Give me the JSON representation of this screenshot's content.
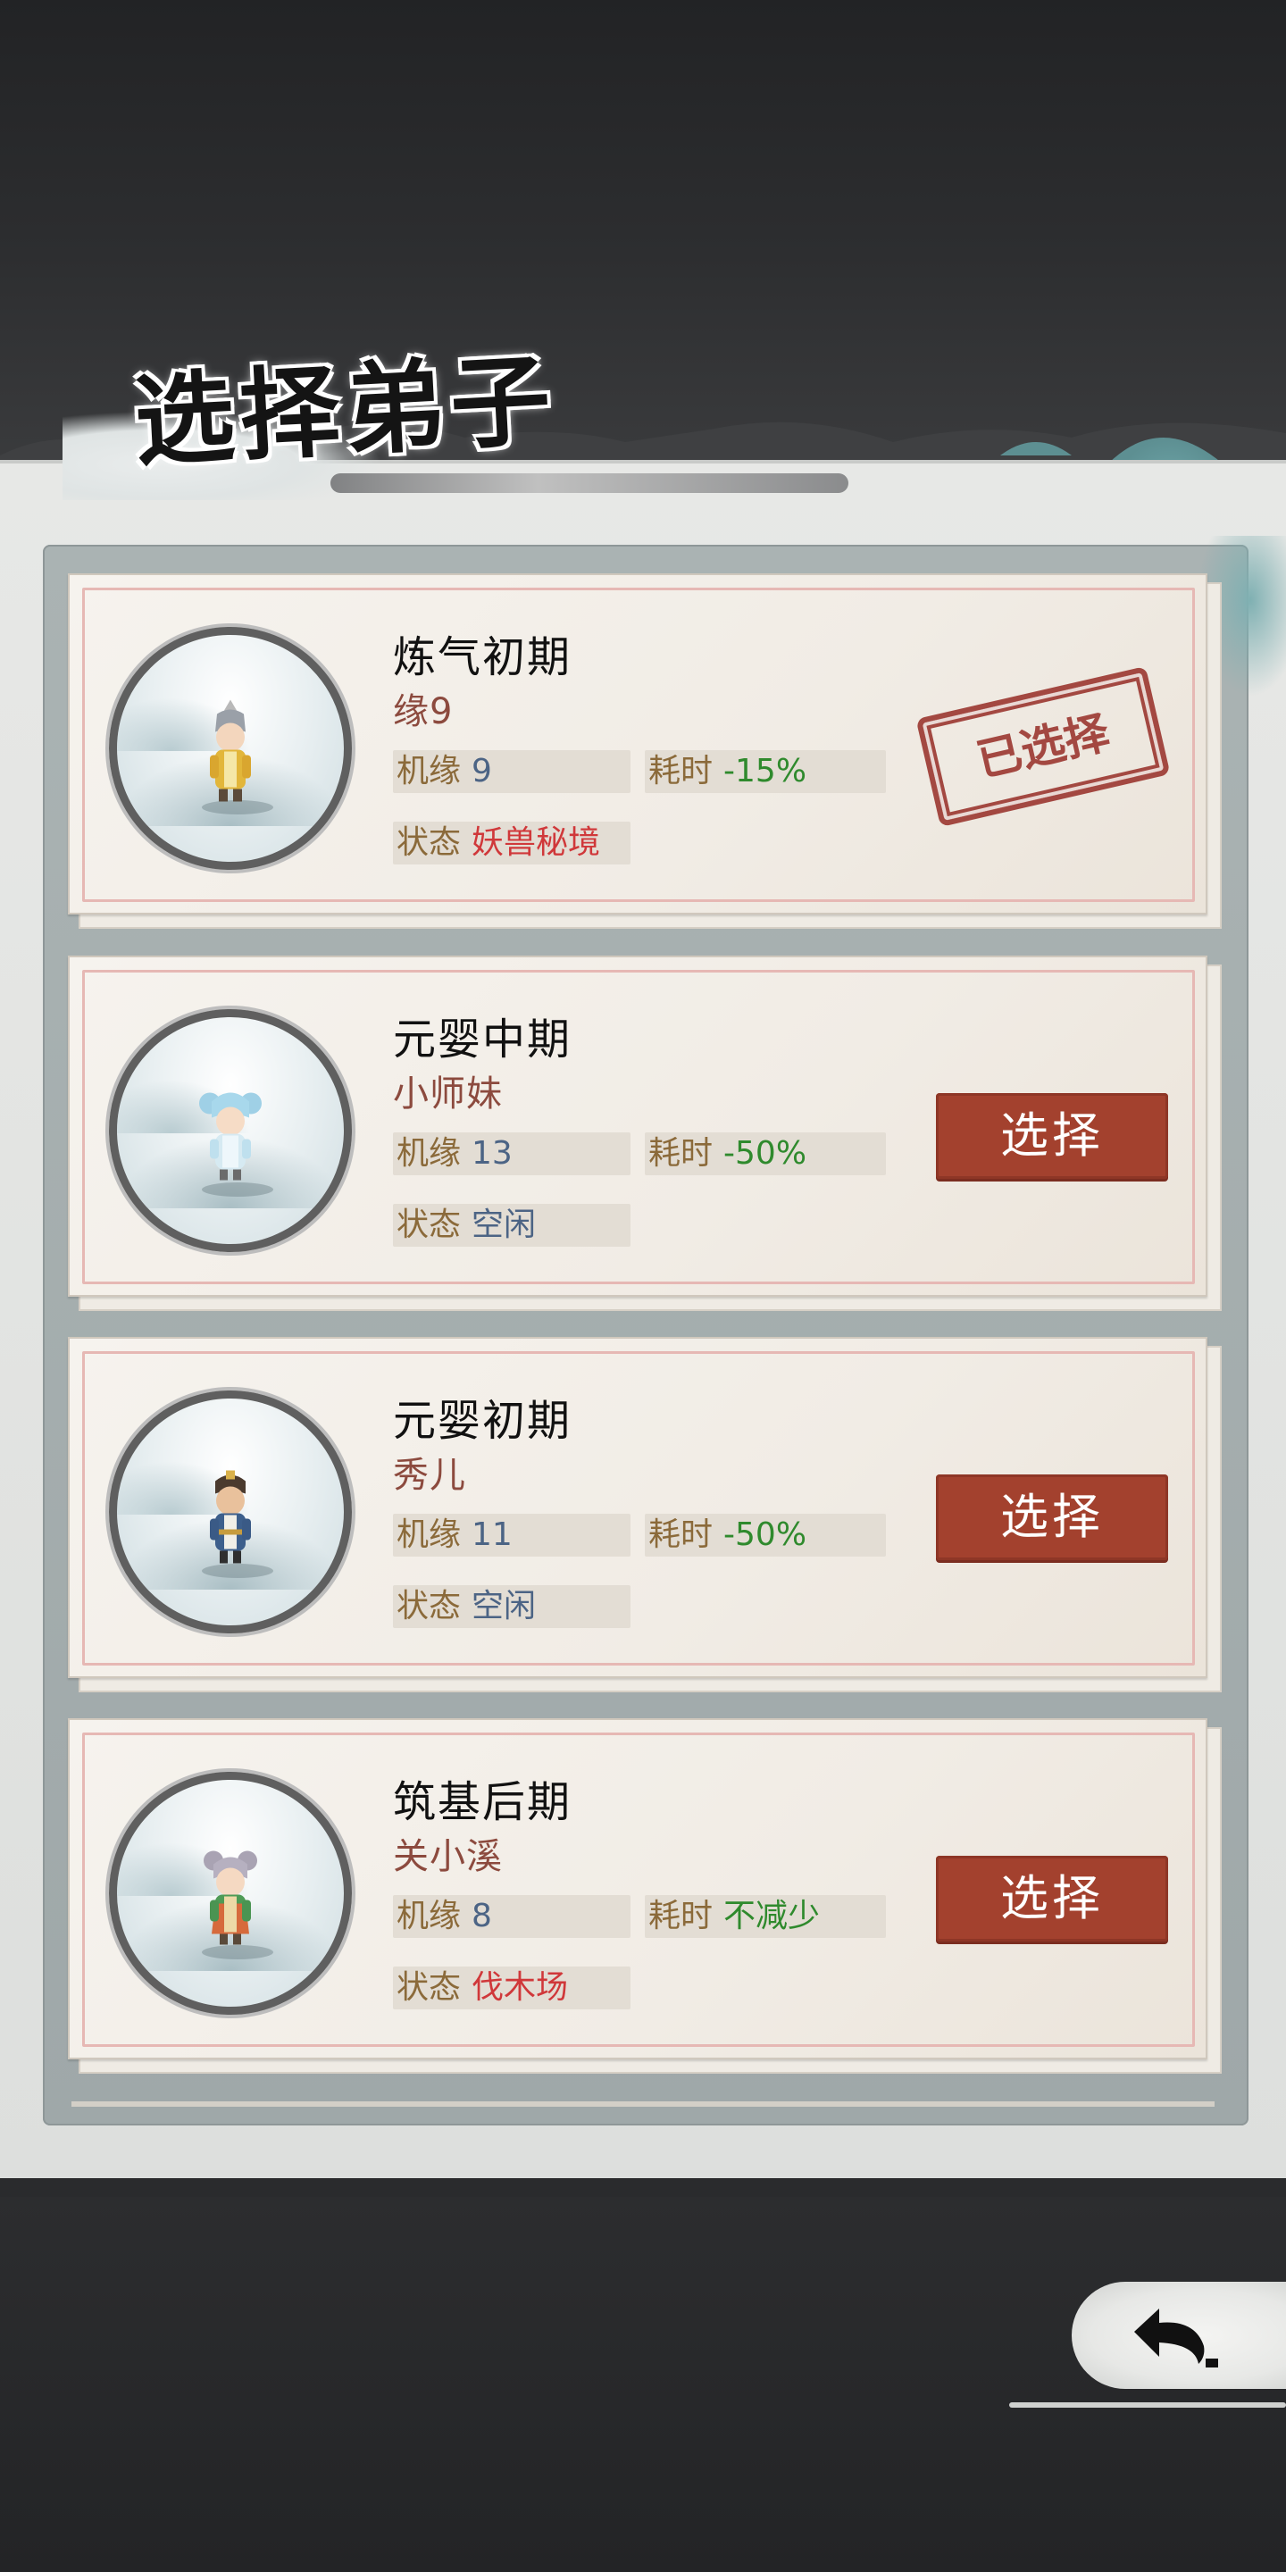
{
  "title": "选择弟子",
  "characters": [
    {
      "realm": "炼气初期",
      "name": "缘9",
      "stats": {
        "luck_label": "机缘",
        "luck_value": "9",
        "time_label": "耗时",
        "time_value": "-15%",
        "status_label": "状态",
        "status_value": "妖兽秘境"
      },
      "action": "已选择",
      "selected": true,
      "figure_icon": "gold-robed-cultivator"
    },
    {
      "realm": "元婴中期",
      "name": "小师妹",
      "stats": {
        "luck_label": "机缘",
        "luck_value": "13",
        "time_label": "耗时",
        "time_value": "-50%",
        "status_label": "状态",
        "status_value": "空闲"
      },
      "action": "选择",
      "selected": false,
      "figure_icon": "blue-haired-girl"
    },
    {
      "realm": "元婴初期",
      "name": "秀儿",
      "stats": {
        "luck_label": "机缘",
        "luck_value": "11",
        "time_label": "耗时",
        "time_value": "-50%",
        "status_label": "状态",
        "status_value": "空闲"
      },
      "action": "选择",
      "selected": false,
      "figure_icon": "blue-robed-boy"
    },
    {
      "realm": "筑基后期",
      "name": "关小溪",
      "stats": {
        "luck_label": "机缘",
        "luck_value": "8",
        "time_label": "耗时",
        "time_value": "不减少",
        "status_label": "状态",
        "status_value": "伐木场"
      },
      "action": "选择",
      "selected": false,
      "figure_icon": "green-robed-girl"
    }
  ],
  "back_icon": "back-arrow-icon",
  "colors": {
    "button": "#a3412e",
    "stamp": "#9d3b34",
    "green": "#2f8a2d",
    "red": "#d0383a",
    "blue": "#4c6485",
    "name": "#8c4a3e"
  }
}
